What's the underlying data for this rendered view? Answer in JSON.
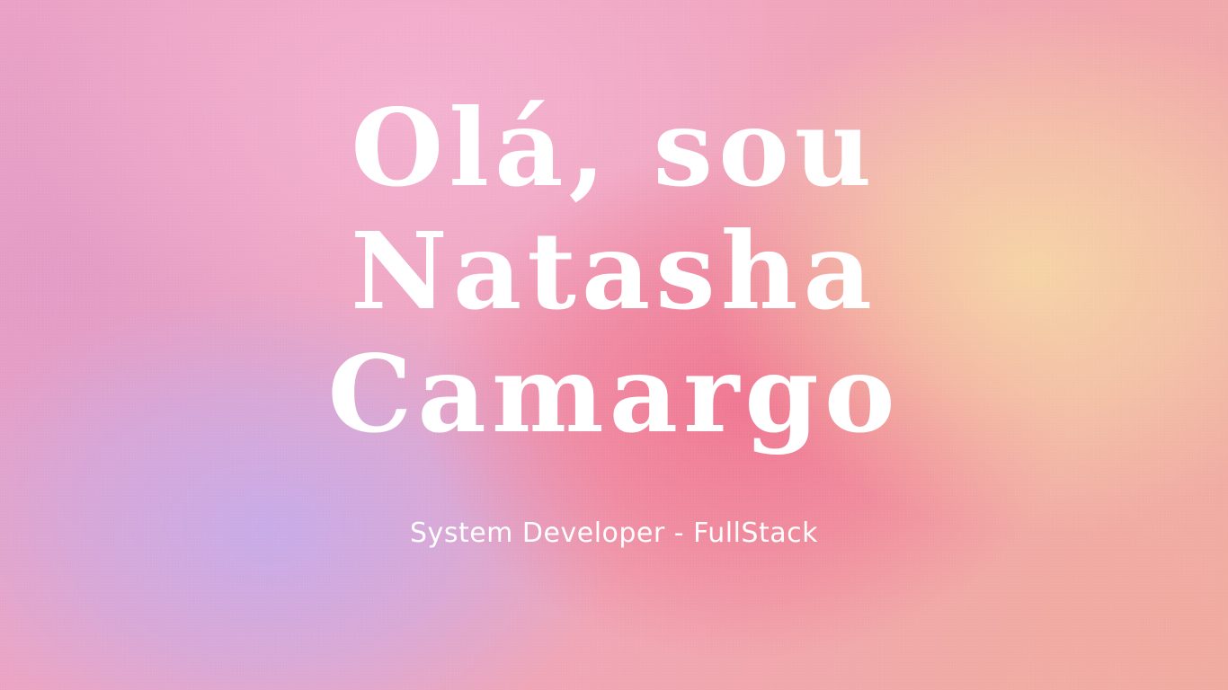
{
  "hero": {
    "headline_lines": [
      "Olá, sou",
      "Natasha",
      "Camargo"
    ],
    "subtitle": "System Developer - FullStack"
  },
  "colors": {
    "text": "#ffffff",
    "gradient_pink": "#efa7c0",
    "gradient_lavender": "#c6acea",
    "gradient_coral": "#f07691",
    "gradient_peach": "#f6d6a6"
  }
}
